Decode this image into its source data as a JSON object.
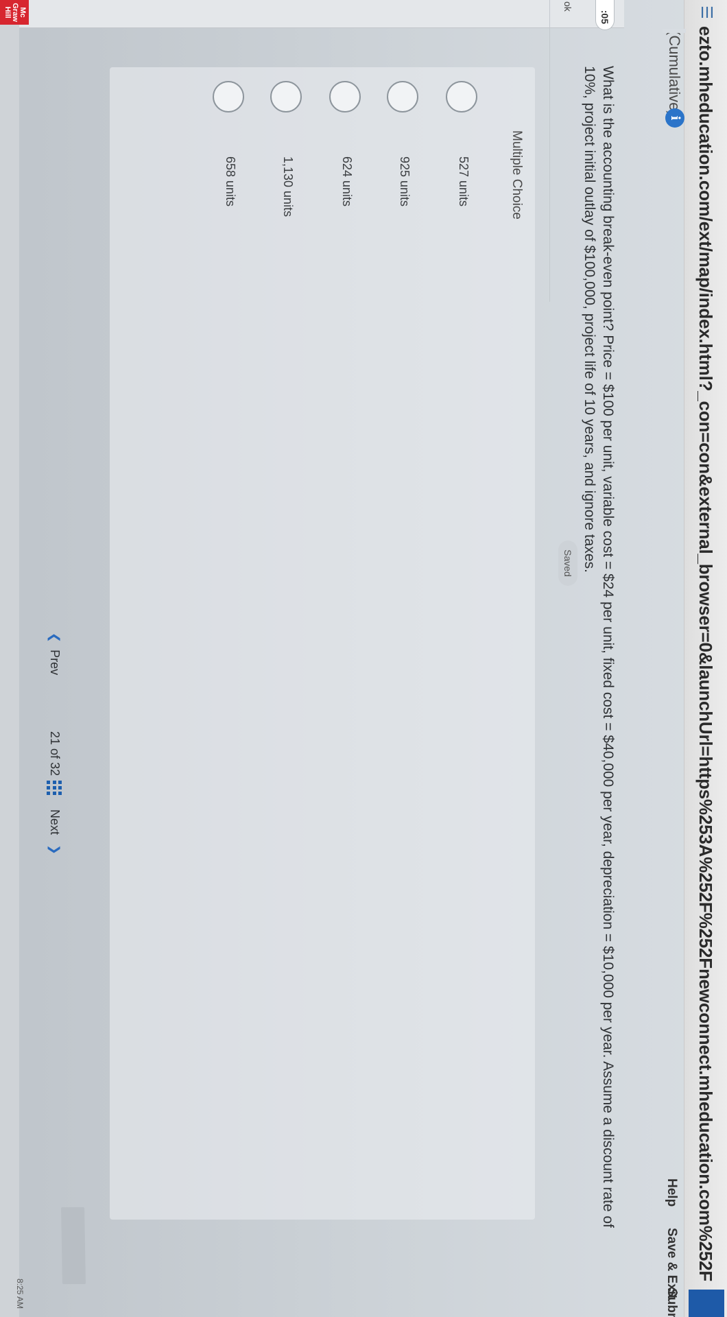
{
  "browser": {
    "url": "ezto.mheducation.com/ext/map/index.html?_con=con&external_browser=0&launchUrl=https%253A%252F%252Fnewconnect.mheducation.com%252F"
  },
  "header": {
    "title": "(Cumulative)",
    "info_icon": "info-icon",
    "help": "Help",
    "save_exit": "Save & Exit",
    "submit": "Submit"
  },
  "side_panel": {
    "badge": ":05",
    "label": "ok"
  },
  "status": {
    "saved": "Saved"
  },
  "question": {
    "text": "What is the accounting break-even point? Price = $100 per unit, variable cost = $24 per unit, fixed cost = $40,000 per year, depreciation = $10,000 per year. Assume a discount rate of 10%, project initial outlay of $100,000, project life of 10 years, and ignore taxes.",
    "type_label": "Multiple Choice",
    "choices": [
      {
        "label": "527 units"
      },
      {
        "label": "925 units"
      },
      {
        "label": "624 units"
      },
      {
        "label": "1,130 units"
      },
      {
        "label": "658 units"
      }
    ]
  },
  "navigation": {
    "prev": "Prev",
    "current": "21",
    "of": "of",
    "total": "32",
    "next": "Next"
  },
  "brand": {
    "logo_lines": [
      "Mc",
      "Graw",
      "Hill"
    ]
  },
  "system": {
    "clock": "8:25 AM"
  },
  "colors": {
    "accent": "#2b74c9",
    "brand_red": "#d7262f",
    "background": "#cdd3d8"
  }
}
